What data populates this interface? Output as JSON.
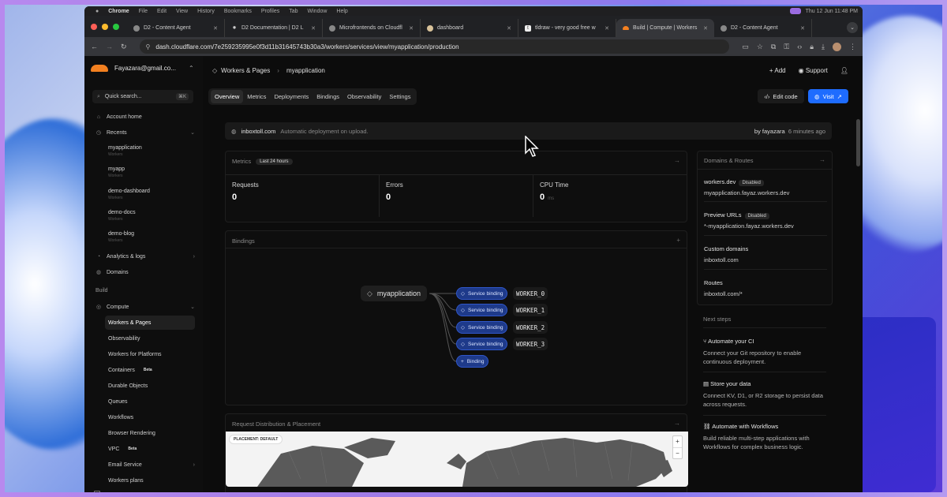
{
  "macos_menu": [
    "Chrome",
    "File",
    "Edit",
    "View",
    "History",
    "Bookmarks",
    "Profiles",
    "Tab",
    "Window",
    "Help"
  ],
  "menu_clock": "Thu 12 Jun 11:48 PM",
  "tabs": [
    {
      "title": "D2 - Content Agent",
      "icon": "github-icon"
    },
    {
      "title": "D2 Documentation | D2 L",
      "icon": "gear-icon"
    },
    {
      "title": "Microfrontends on Cloudfl",
      "icon": "github-icon"
    },
    {
      "title": "dashboard",
      "icon": "sparkle-icon"
    },
    {
      "title": "tldraw - very good free w",
      "icon": "tldraw-icon"
    },
    {
      "title": "Build | Compute | Workers",
      "icon": "cloudflare-icon",
      "active": true
    },
    {
      "title": "D2 - Content Agent",
      "icon": "github-icon"
    }
  ],
  "address": {
    "url": "dash.cloudflare.com/7e259235995e0f3d11b31645743b30a3/workers/services/view/myapplication/production"
  },
  "account": {
    "email": "Fayazara@gmail.co..."
  },
  "search": {
    "label": "Quick search...",
    "shortcut": "⌘K"
  },
  "sidebar": {
    "account_home": "Account home",
    "recents": "Recents",
    "recent_items": [
      {
        "name": "myapplication",
        "sub": "Workers"
      },
      {
        "name": "myapp",
        "sub": "Workers"
      },
      {
        "name": "demo-dashboard",
        "sub": "Workers"
      },
      {
        "name": "demo-docs",
        "sub": "Workers"
      },
      {
        "name": "demo-blog",
        "sub": "Workers"
      }
    ],
    "analytics": "Analytics & logs",
    "domains": "Domains",
    "build_section": "Build",
    "compute": "Compute",
    "compute_items": [
      {
        "name": "Workers & Pages",
        "active": true
      },
      {
        "name": "Observability"
      },
      {
        "name": "Workers for Platforms"
      },
      {
        "name": "Containers",
        "badge": "Beta"
      },
      {
        "name": "Durable Objects"
      },
      {
        "name": "Queues"
      },
      {
        "name": "Workflows"
      },
      {
        "name": "Browser Rendering"
      },
      {
        "name": "VPC",
        "badge": "Beta"
      },
      {
        "name": "Email Service"
      },
      {
        "name": "Workers plans"
      }
    ]
  },
  "header": {
    "crumb1": "Workers & Pages",
    "crumb2": "myapplication",
    "add": "Add",
    "support": "Support"
  },
  "page_tabs": [
    "Overview",
    "Metrics",
    "Deployments",
    "Bindings",
    "Observability",
    "Settings"
  ],
  "buttons": {
    "edit_code": "Edit code",
    "visit": "Visit"
  },
  "deployment": {
    "domain": "inboxtoll.com",
    "message": "Automatic deployment on upload.",
    "by": "by fayazara",
    "time": "6 minutes ago"
  },
  "metrics": {
    "title": "Metrics",
    "range": "Last 24 hours",
    "items": [
      {
        "label": "Requests",
        "value": "0",
        "unit": ""
      },
      {
        "label": "Errors",
        "value": "0",
        "unit": ""
      },
      {
        "label": "CPU Time",
        "value": "0",
        "unit": "ms"
      }
    ]
  },
  "bindings": {
    "title": "Bindings",
    "app": "myapplication",
    "service_label": "Service binding",
    "workers": [
      "WORKER_0",
      "WORKER_1",
      "WORKER_2",
      "WORKER_3"
    ],
    "add": "Binding"
  },
  "distribution": {
    "title": "Request Distribution & Placement",
    "badge": "PLACEMENT: DEFAULT"
  },
  "domains_routes": {
    "title": "Domains & Routes",
    "workers_dev": {
      "label": "workers.dev",
      "badge": "Disabled",
      "value": "myapplication.fayaz.workers.dev"
    },
    "preview": {
      "label": "Preview URLs",
      "badge": "Disabled",
      "value": "*-myapplication.fayaz.workers.dev"
    },
    "custom": {
      "label": "Custom domains",
      "value": "inboxtoll.com"
    },
    "routes": {
      "label": "Routes",
      "value": "inboxtoll.com/*"
    }
  },
  "next_steps": {
    "title": "Next steps",
    "items": [
      {
        "title": "Automate your CI",
        "desc": "Connect your Git repository to enable continuous deployment."
      },
      {
        "title": "Store your data",
        "desc": "Connect KV, D1, or R2 storage to persist data across requests."
      },
      {
        "title": "Automate with Workflows",
        "desc": "Build reliable multi-step applications with Workflows for complex business logic."
      }
    ]
  }
}
